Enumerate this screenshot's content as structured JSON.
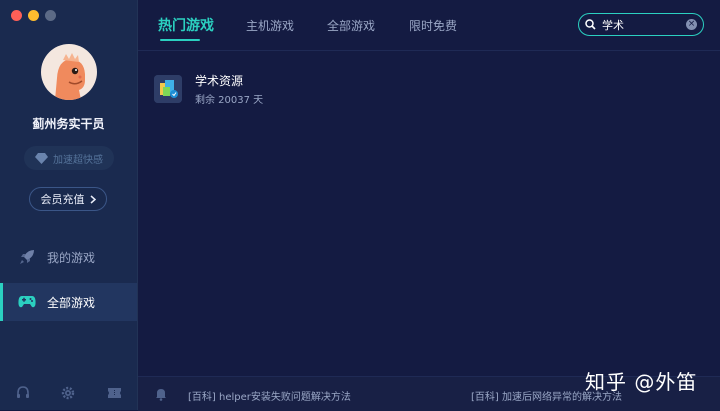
{
  "sidebar": {
    "user_name": "蓟州务实干员",
    "speedup_label": "加速超快感",
    "vip_button_label": "会员充值",
    "nav": [
      {
        "label": "我的游戏",
        "icon": "rocket-icon",
        "active": false
      },
      {
        "label": "全部游戏",
        "icon": "gamepad-icon",
        "active": true
      }
    ],
    "footer_icons": [
      "headset-icon",
      "gear-icon",
      "ticket-icon"
    ]
  },
  "tabs": [
    {
      "label": "热门游戏",
      "active": true
    },
    {
      "label": "主机游戏",
      "active": false
    },
    {
      "label": "全部游戏",
      "active": false
    },
    {
      "label": "限时免费",
      "active": false
    }
  ],
  "search": {
    "value": "学术"
  },
  "results": [
    {
      "title": "学术资源",
      "subtitle": "剩余 20037 天"
    }
  ],
  "footer": {
    "tip_left": "[百科] helper安装失败问题解决方法",
    "tip_right": "[百科] 加速后网络异常的解决方法"
  },
  "watermark": "知乎 @外笛",
  "colors": {
    "accent": "#2bd0c0",
    "sidebar_bg": "#1a2a4f",
    "main_bg": "#141b42"
  }
}
